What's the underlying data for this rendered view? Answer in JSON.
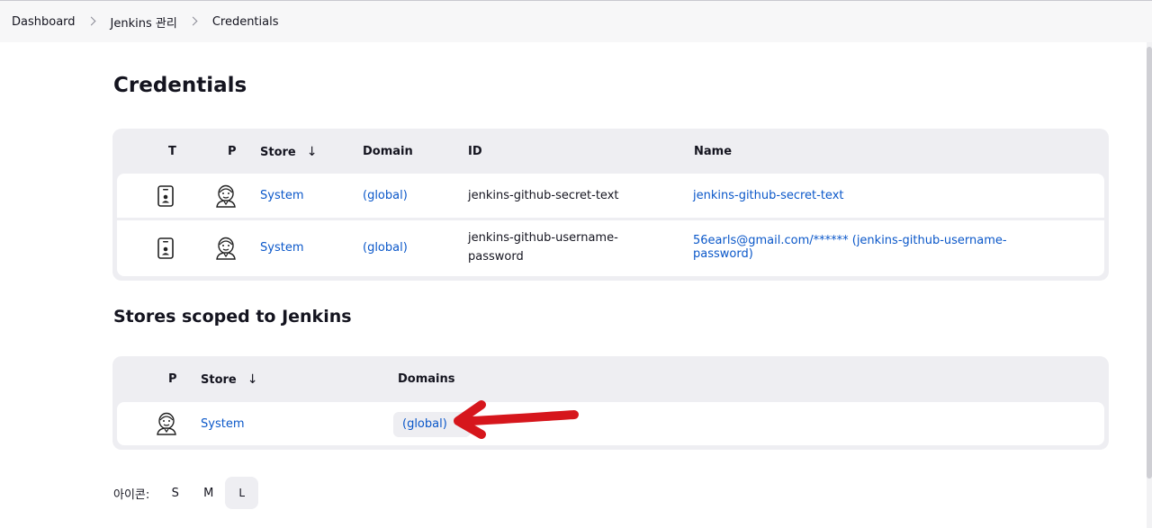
{
  "breadcrumb": [
    "Dashboard",
    "Jenkins 관리",
    "Credentials"
  ],
  "page_title": "Credentials",
  "credentials_table": {
    "headers": {
      "t": "T",
      "p": "P",
      "store": "Store",
      "sort": "↓",
      "domain": "Domain",
      "id": "ID",
      "name": "Name"
    },
    "rows": [
      {
        "store": "System",
        "domain": "(global)",
        "id": "jenkins-github-secret-text",
        "id_lines": [
          "jenkins-github-secret-text"
        ],
        "name_lines": [
          "jenkins-github-secret-text"
        ]
      },
      {
        "store": "System",
        "domain": "(global)",
        "id": "jenkins-github-username-password",
        "id_lines": [
          "jenkins-github-username-",
          "password"
        ],
        "name_lines": [
          "56earls@gmail.com/****** (jenkins-github-username-",
          "password)"
        ]
      }
    ]
  },
  "stores_section_title": "Stores scoped to Jenkins",
  "stores_table": {
    "headers": {
      "p": "P",
      "store": "Store",
      "sort": "↓",
      "domains": "Domains"
    },
    "rows": [
      {
        "store": "System",
        "domain": "(global)"
      }
    ]
  },
  "icon_size": {
    "label": "아이콘:",
    "options": [
      "S",
      "M",
      "L"
    ],
    "selected": "L"
  },
  "colors": {
    "link": "#0a57c9",
    "annotation_arrow": "#d6161c",
    "table_bg": "#eeeef2"
  }
}
